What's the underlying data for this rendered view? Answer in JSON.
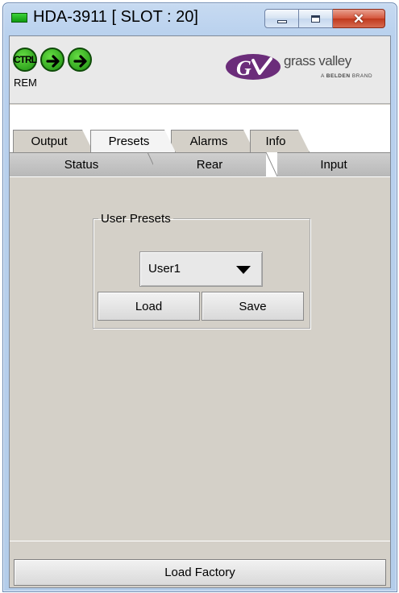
{
  "window": {
    "title": "HDA-3911 [ SLOT : 20]",
    "min_icon": "minimize-icon",
    "max_icon": "maximize-icon",
    "close_icon": "close-icon"
  },
  "header": {
    "ctrl_label": "CTRL",
    "rem_label": "REM",
    "brand_name": "grass valley",
    "brand_tagline_prefix": "A ",
    "brand_tagline_bold": "BELDEN",
    "brand_tagline_suffix": " BRAND"
  },
  "tabs": {
    "row1": [
      "Output",
      "Presets",
      "Alarms",
      "Info"
    ],
    "active": "Presets",
    "row2": [
      "Status",
      "Rear",
      "Input"
    ]
  },
  "presets": {
    "group_label": "User Presets",
    "selected": "User1",
    "load_label": "Load",
    "save_label": "Save"
  },
  "footer": {
    "load_factory_label": "Load Factory"
  },
  "colors": {
    "status_green": "#1c8f10",
    "brand_purple": "#6b2d7a",
    "close_red": "#c0391d"
  }
}
